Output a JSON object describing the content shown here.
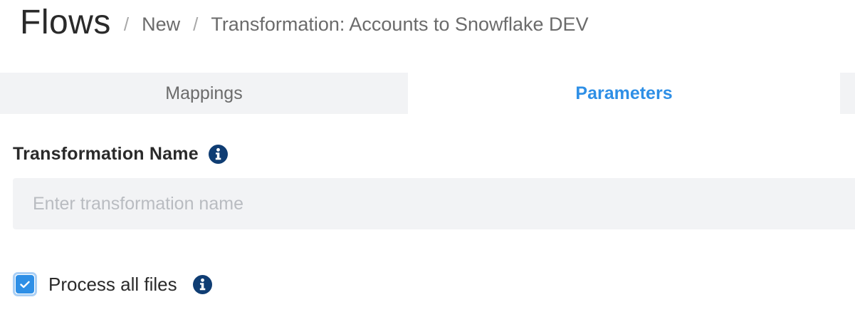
{
  "breadcrumb": {
    "root": "Flows",
    "separator": "/",
    "items": [
      "New",
      "Transformation: Accounts to Snowflake DEV"
    ]
  },
  "tabs": [
    {
      "label": "Mappings",
      "active": false
    },
    {
      "label": "Parameters",
      "active": true
    }
  ],
  "transformation_name": {
    "label": "Transformation Name",
    "value": "",
    "placeholder": "Enter transformation name",
    "info_icon": "info-circle-icon"
  },
  "process_all_files": {
    "label": "Process all files",
    "checked": true,
    "info_icon": "info-circle-icon"
  },
  "colors": {
    "accent": "#2e8fe6",
    "info_icon": "#0f3d73",
    "tab_inactive_bg": "#f2f3f5"
  }
}
